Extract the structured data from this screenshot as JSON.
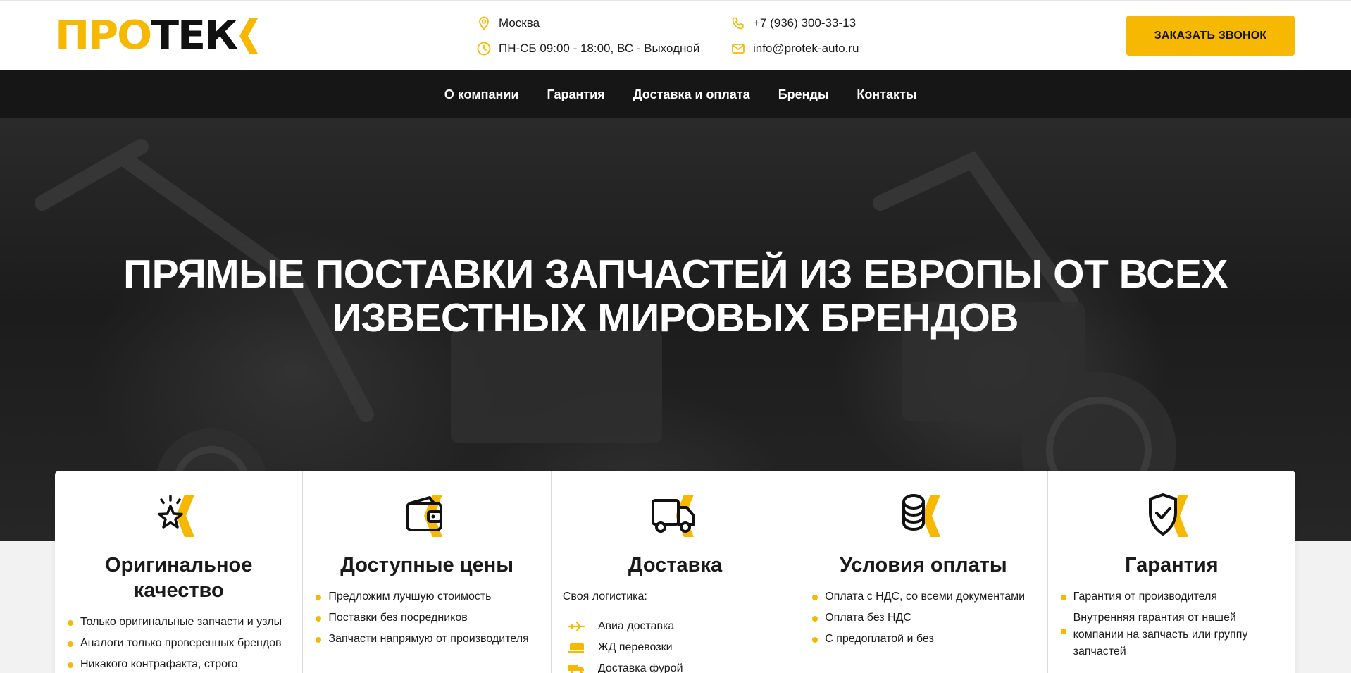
{
  "logo": {
    "part1": "ПРО",
    "part2": "ТЕК"
  },
  "header": {
    "city": "Москва",
    "hours": "ПН-СБ 09:00 - 18:00, ВС - Выходной",
    "phone": "+7 (936) 300-33-13",
    "email": "info@protek-auto.ru",
    "cta_label": "ЗАКАЗАТЬ ЗВОНОК"
  },
  "nav": {
    "items": [
      "О компании",
      "Гарантия",
      "Доставка и оплата",
      "Бренды",
      "Контакты"
    ]
  },
  "hero": {
    "title_line1": "ПРЯМЫЕ ПОСТАВКИ ЗАПЧАСТЕЙ ИЗ ЕВРОПЫ ОТ ВСЕХ",
    "title_line2": "ИЗВЕСТНЫХ МИРОВЫХ БРЕНДОВ"
  },
  "features": [
    {
      "icon": "star-icon",
      "title_line1": "Оригинальное",
      "title_line2": "качество",
      "items": [
        "Только оригинальные запчасти и узлы",
        "Аналоги только проверенных брендов",
        "Никакого контрафакта, строго"
      ]
    },
    {
      "icon": "wallet-icon",
      "title": "Доступные цены",
      "items": [
        "Предложим лучшую стоимость",
        "Поставки без посредников",
        "Запчасти напрямую от производителя"
      ]
    },
    {
      "icon": "truck-icon",
      "title": "Доставка",
      "intro": "Своя логистика:",
      "items": [
        "Авиа доставка",
        "ЖД перевозки",
        "Доставка фурой"
      ]
    },
    {
      "icon": "coins-icon",
      "title": "Условия оплаты",
      "items": [
        "Оплата с НДС, со всеми документами",
        "Оплата без НДС",
        "С предоплатой и без"
      ]
    },
    {
      "icon": "shield-check-icon",
      "title": "Гарантия",
      "items": [
        "Гарантия от производителя",
        "Внутренняя гарантия от нашей компании на запчасть или группу запчастей"
      ]
    }
  ],
  "colors": {
    "accent": "#f6b800",
    "dark": "#161616",
    "text": "#1a1a1a"
  }
}
